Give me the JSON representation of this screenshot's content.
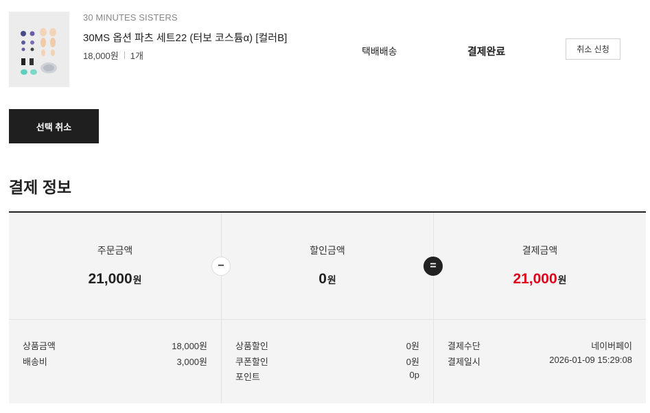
{
  "product": {
    "brand": "30 MINUTES SISTERS",
    "name": "30MS 옵션 파츠 세트22 (터보 코스튬α) [컬러B]",
    "price": "18,000원",
    "quantity": "1개",
    "delivery": "택배배송",
    "status": "결제완료",
    "cancel_request_label": "취소 신청"
  },
  "select_cancel_label": "선택 취소",
  "section_title": "결제 정보",
  "payment": {
    "order_amount": {
      "label": "주문금액",
      "value": "21,000",
      "unit": "원"
    },
    "discount_amount": {
      "label": "할인금액",
      "value": "0",
      "unit": "원"
    },
    "paid_amount": {
      "label": "결제금액",
      "value": "21,000",
      "unit": "원"
    },
    "minus_symbol": "−",
    "equals_symbol": "=",
    "order_details": [
      {
        "label": "상품금액",
        "value": "18,000원"
      },
      {
        "label": "배송비",
        "value": "3,000원"
      }
    ],
    "discount_details": [
      {
        "label": "상품할인",
        "value": "0원"
      },
      {
        "label": "쿠폰할인",
        "value": "0원"
      },
      {
        "label": "포인트",
        "value": "0p"
      }
    ],
    "pay_details": [
      {
        "label": "결제수단",
        "value": "네이버페이"
      },
      {
        "label": "결제일시",
        "value": "2026-01-09 15:29:08"
      }
    ]
  },
  "colors": {
    "accent_red": "#e0001b",
    "dark": "#1f1f1f",
    "box_bg": "#f4f4f4"
  }
}
